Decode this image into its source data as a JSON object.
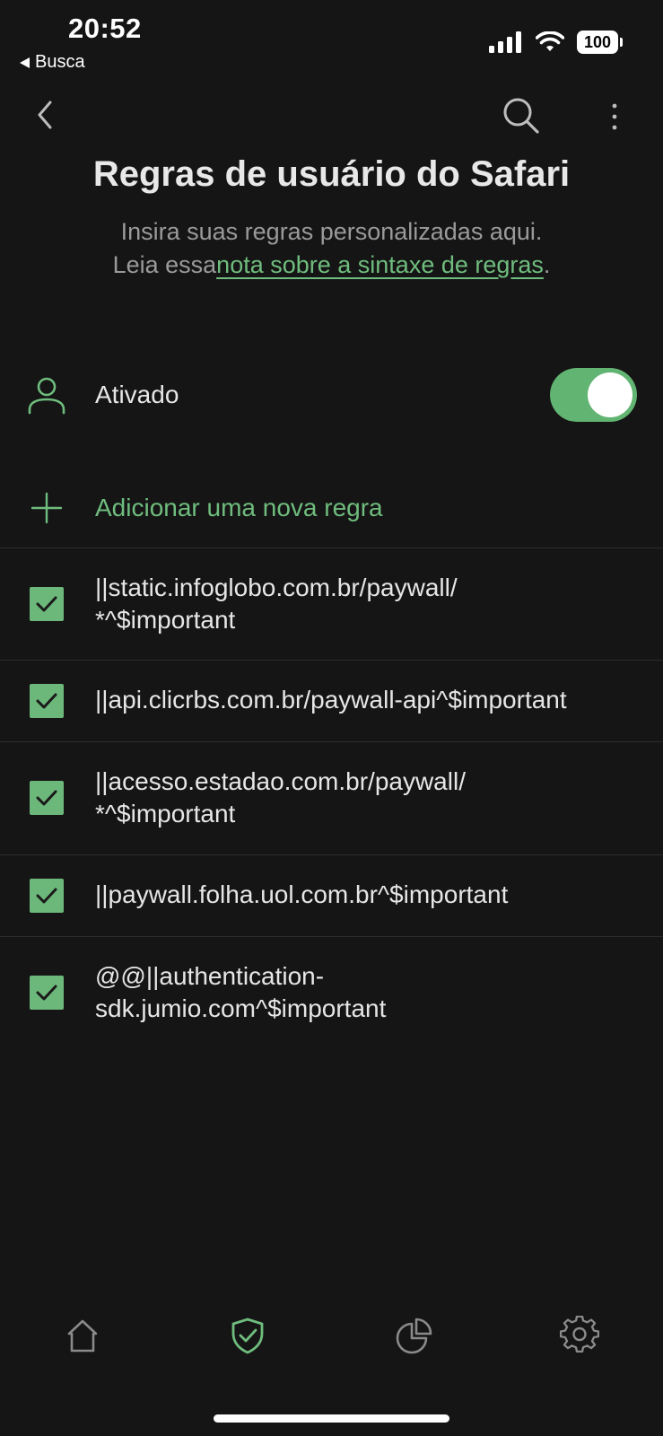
{
  "status_bar": {
    "time": "20:52",
    "back_app": "Busca",
    "battery": "100"
  },
  "header": {
    "title": "Regras de usuário do Safari",
    "subtitle_line1": "Insira suas regras personalizadas aqui.",
    "subtitle_prefix": "Leia essa",
    "subtitle_link": "nota sobre a sintaxe de regras",
    "subtitle_suffix": "."
  },
  "enabled": {
    "label": "Ativado",
    "on": true
  },
  "add_rule": {
    "label": "Adicionar uma nova regra"
  },
  "rules": [
    {
      "text": "||static.infoglobo.com.br/paywall/\n*^$important",
      "checked": true
    },
    {
      "text": "||api.clicrbs.com.br/paywall-api^$important",
      "checked": true
    },
    {
      "text": "||acesso.estadao.com.br/paywall/\n*^$important",
      "checked": true
    },
    {
      "text": "||paywall.folha.uol.com.br^$important",
      "checked": true
    },
    {
      "text": "@@||authentication-\nsdk.jumio.com^$important",
      "checked": true
    }
  ],
  "tab_bar": {
    "items": [
      "home-icon",
      "shield-check-icon",
      "pie-chart-icon",
      "gear-icon"
    ],
    "active": "shield-check-icon"
  },
  "colors": {
    "background": "#151515",
    "accent": "#6fbd7e",
    "toggle_on": "#62b472",
    "text": "#e6e6e6",
    "muted": "#9a9a9a"
  }
}
